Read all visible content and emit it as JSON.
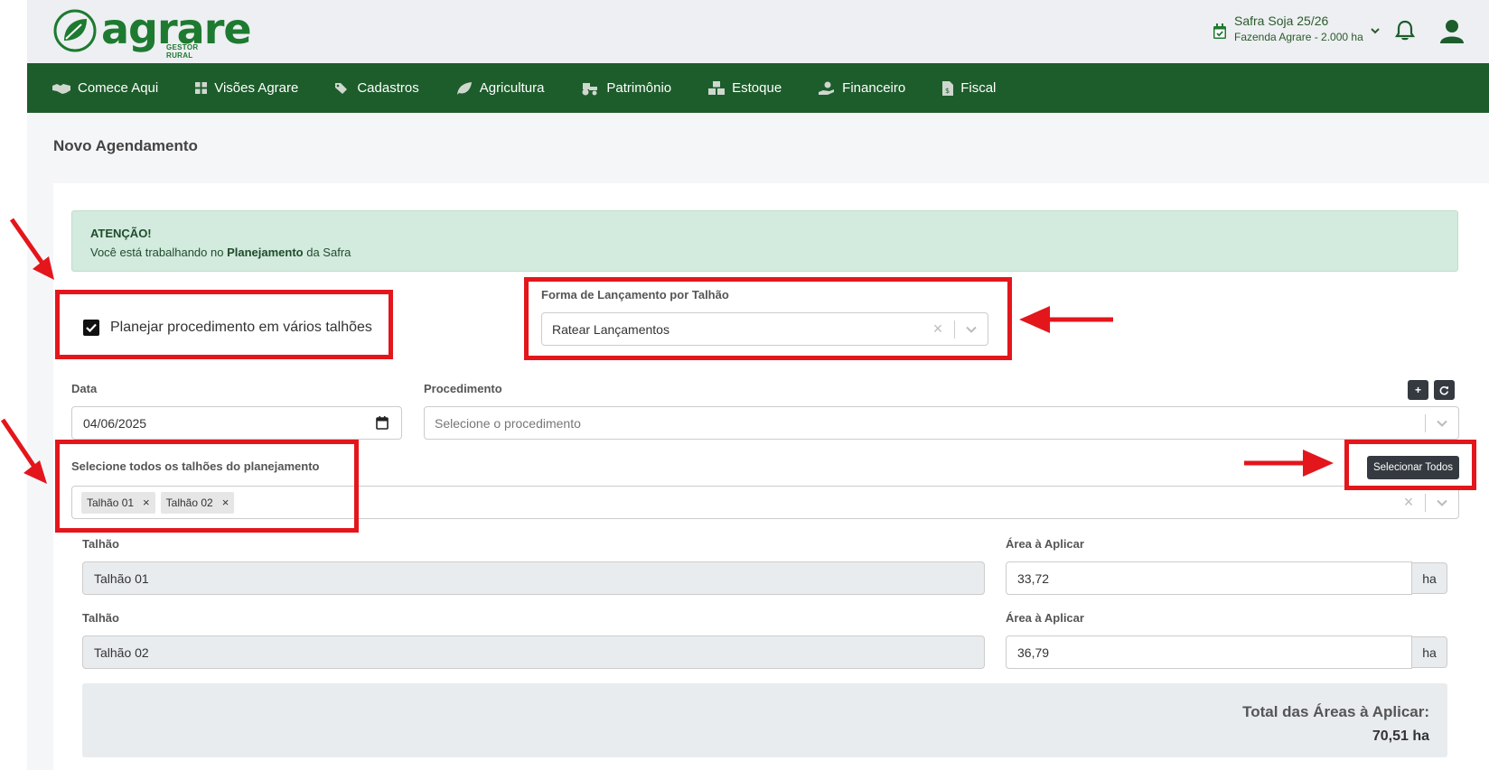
{
  "brand": {
    "name": "agrare",
    "subtitle": "GESTOR RURAL"
  },
  "header": {
    "safra_name": "Safra Soja 25/26",
    "farm_name": "Fazenda Agrare - 2.000 ha"
  },
  "nav": {
    "items": [
      {
        "label": "Comece Aqui",
        "icon": "handshake-icon"
      },
      {
        "label": "Visões Agrare",
        "icon": "grid-icon"
      },
      {
        "label": "Cadastros",
        "icon": "tags-icon"
      },
      {
        "label": "Agricultura",
        "icon": "leaf-icon"
      },
      {
        "label": "Patrimônio",
        "icon": "tractor-icon"
      },
      {
        "label": "Estoque",
        "icon": "boxes-icon"
      },
      {
        "label": "Financeiro",
        "icon": "hand-money-icon"
      },
      {
        "label": "Fiscal",
        "icon": "invoice-icon"
      }
    ]
  },
  "page": {
    "title": "Novo Agendamento"
  },
  "alert": {
    "heading": "ATENÇÃO!",
    "text_before": "Você está trabalhando no",
    "highlight": "Planejamento",
    "text_after": "da Safra"
  },
  "form": {
    "multi_checkbox_label": "Planejar procedimento em vários talhões",
    "multi_checked": true,
    "forma_label": "Forma de Lançamento por Talhão",
    "forma_value": "Ratear Lançamentos",
    "data_label": "Data",
    "data_value": "04/06/2025",
    "procedimento_label": "Procedimento",
    "procedimento_placeholder": "Selecione o procedimento",
    "talhoes_label": "Selecione todos os talhões do planejamento",
    "selecionar_todos": "Selecionar Todos",
    "selected_talhoes": [
      "Talhão 01",
      "Talhão 02"
    ],
    "add_symbol": "+",
    "rows": [
      {
        "talhao_label": "Talhão",
        "talhao_value": "Talhão 01",
        "area_label": "Área à Aplicar",
        "area_value": "33,72",
        "unit": "ha"
      },
      {
        "talhao_label": "Talhão",
        "talhao_value": "Talhão 02",
        "area_label": "Área à Aplicar",
        "area_value": "36,79",
        "unit": "ha"
      }
    ],
    "total_label": "Total das Áreas à Aplicar:",
    "total_value": "70,51 ha"
  },
  "colors": {
    "brand_green": "#1e7a30",
    "nav_bg": "#1d5d2b",
    "annotation_red": "#e3161c",
    "alert_bg": "#d3eade"
  }
}
